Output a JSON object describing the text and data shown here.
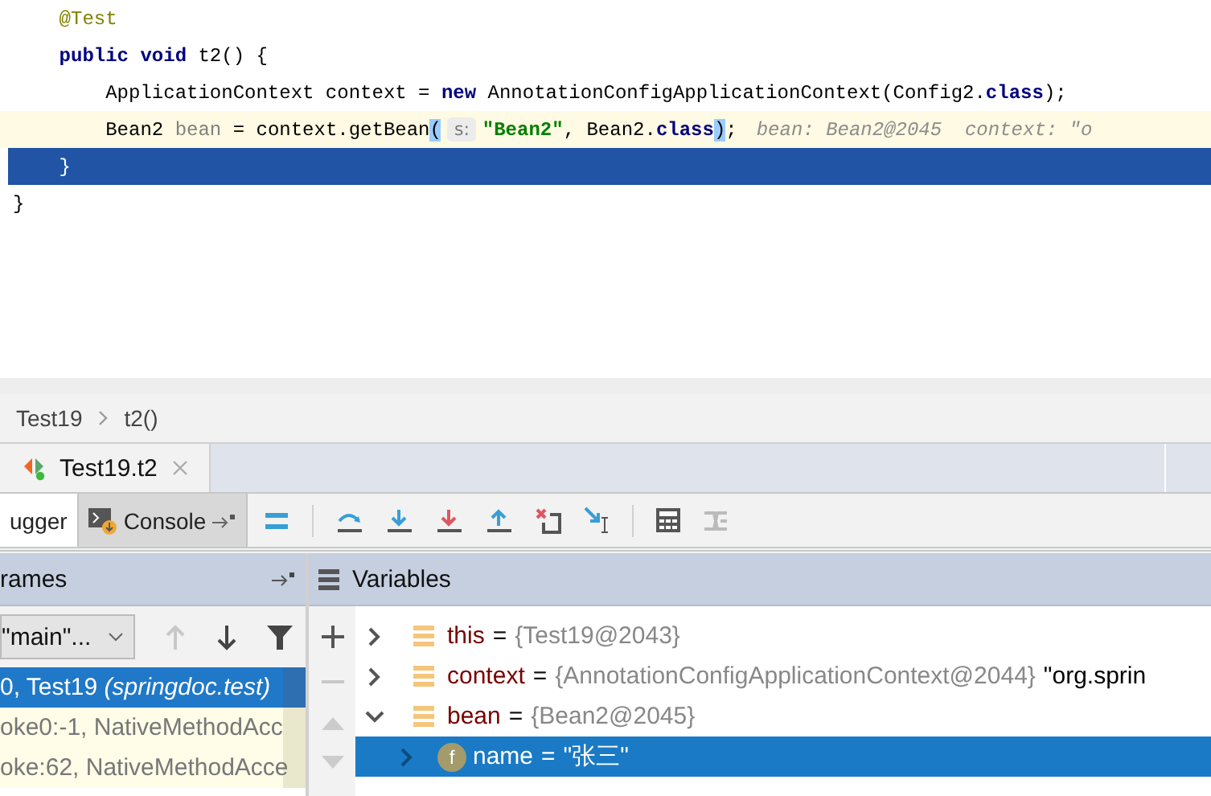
{
  "editor": {
    "lines": [
      {
        "current": false,
        "selected": false,
        "tokens": [
          {
            "kind": "annotation",
            "text": "    @Test"
          }
        ]
      },
      {
        "current": false,
        "selected": false,
        "tokens": [
          {
            "kind": "keyword",
            "text": "    public void "
          },
          {
            "kind": "plain",
            "text": "t2() {"
          }
        ]
      },
      {
        "current": false,
        "selected": false,
        "tokens": [
          {
            "kind": "plain",
            "text": "        ApplicationContext context = "
          },
          {
            "kind": "keyword",
            "text": "new "
          },
          {
            "kind": "plain",
            "text": "AnnotationConfigApplicationContext(Config2."
          },
          {
            "kind": "keyword",
            "text": "class"
          },
          {
            "kind": "plain",
            "text": ");"
          }
        ]
      },
      {
        "current": true,
        "selected": false,
        "tokens": [
          {
            "kind": "plain",
            "text": "        Bean2 "
          },
          {
            "kind": "unused",
            "text": "bean"
          },
          {
            "kind": "plain",
            "text": " = context.getBean"
          },
          {
            "kind": "brace-match",
            "text": "("
          },
          {
            "kind": "param-hint",
            "text": "s:"
          },
          {
            "kind": "string",
            "text": "\"Bean2\""
          },
          {
            "kind": "plain",
            "text": ", Bean2."
          },
          {
            "kind": "keyword",
            "text": "class"
          },
          {
            "kind": "brace-match",
            "text": ")"
          },
          {
            "kind": "plain",
            "text": ";"
          },
          {
            "kind": "inline-hint",
            "text": "bean: Bean2@2045  context: \"o"
          }
        ]
      },
      {
        "current": false,
        "selected": true,
        "tokens": [
          {
            "kind": "plain",
            "text": "    }"
          }
        ]
      },
      {
        "current": false,
        "selected": false,
        "tokens": [
          {
            "kind": "plain",
            "text": "}"
          }
        ]
      }
    ]
  },
  "breadcrumb": [
    "Test19",
    "t2()"
  ],
  "debug_tab": {
    "label": "Test19.t2"
  },
  "tool_tabs": [
    {
      "label": "ugger",
      "selected": true
    },
    {
      "label": "Console",
      "selected": false
    }
  ],
  "frames": {
    "title": "rames",
    "thread": "\"main\"...",
    "items": [
      {
        "text": "0, Test19 *(springdoc.test)*",
        "selected": true
      },
      {
        "text": "oke0:-1, NativeMethodAcc",
        "selected": false
      },
      {
        "text": "oke:62, NativeMethodAcce",
        "selected": false
      }
    ]
  },
  "variables": {
    "title": "Variables",
    "items": [
      {
        "kind": "local",
        "name": "this",
        "assign": "=",
        "value": "{Test19@2043}",
        "expanded": false,
        "selected": false
      },
      {
        "kind": "local",
        "name": "context",
        "assign": "=",
        "value": "{AnnotationConfigApplicationContext@2044}",
        "extra": "\"org.sprin",
        "expanded": false,
        "selected": false
      },
      {
        "kind": "local",
        "name": "bean",
        "assign": "=",
        "value": "{Bean2@2045}",
        "expanded": true,
        "selected": false,
        "children": [
          {
            "kind": "field",
            "badge": "f",
            "name": "name",
            "assign": "=",
            "value": "\"张三\"",
            "expanded": false,
            "selected": true
          }
        ]
      }
    ]
  }
}
